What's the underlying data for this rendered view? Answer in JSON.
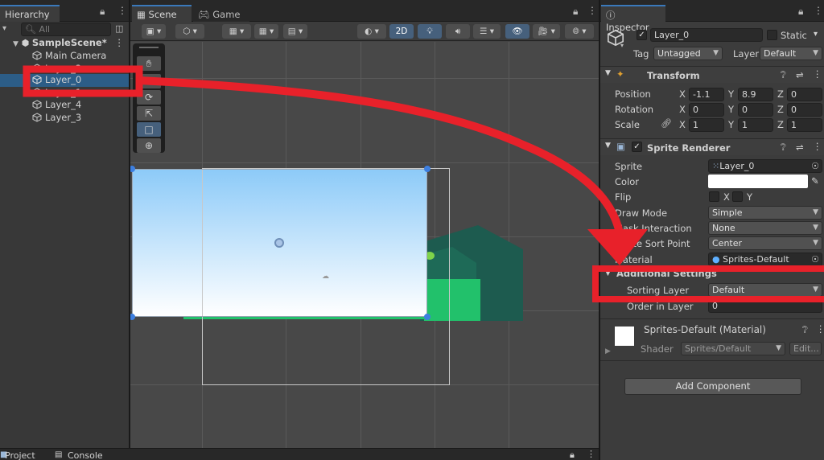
{
  "hierarchy": {
    "tab": "Hierarchy",
    "search_placeholder": "All",
    "scene_name": "SampleScene*",
    "items": [
      "Main Camera",
      "Layer_2",
      "Layer_0",
      "Layer_1",
      "Layer_4",
      "Layer_3"
    ]
  },
  "scene": {
    "tabs": [
      "Scene",
      "Game"
    ],
    "mode_2d": "2D"
  },
  "inspector": {
    "tab": "Inspector",
    "object_name": "Layer_0",
    "static_label": "Static",
    "tag_label": "Tag",
    "tag_value": "Untagged",
    "layer_label": "Layer",
    "layer_value": "Default",
    "transform": {
      "title": "Transform",
      "position_label": "Position",
      "rotation_label": "Rotation",
      "scale_label": "Scale",
      "position": {
        "x": "-1.1",
        "y": "8.9",
        "z": "0"
      },
      "rotation": {
        "x": "0",
        "y": "0",
        "z": "0"
      },
      "scale": {
        "x": "1",
        "y": "1",
        "z": "1"
      }
    },
    "sprite_renderer": {
      "title": "Sprite Renderer",
      "sprite_label": "Sprite",
      "sprite_value": "Layer_0",
      "color_label": "Color",
      "flip_label": "Flip",
      "flip_x": "X",
      "flip_y": "Y",
      "draw_mode_label": "Draw Mode",
      "draw_mode_value": "Simple",
      "mask_label": "Mask Interaction",
      "mask_value": "None",
      "sort_point_label": "Sprite Sort Point",
      "sort_point_value": "Center",
      "material_label": "Material",
      "material_value": "Sprites-Default",
      "additional_settings": "Additional Settings",
      "sorting_layer_label": "Sorting Layer",
      "sorting_layer_value": "Default",
      "order_label": "Order in Layer",
      "order_value": "0"
    },
    "material": {
      "name": "Sprites-Default (Material)",
      "shader_label": "Shader",
      "shader_value": "Sprites/Default",
      "edit_label": "Edit..."
    },
    "add_component": "Add Component"
  },
  "bottom": {
    "tabs": [
      "Project",
      "Console"
    ]
  },
  "colors": {
    "selection": "#2c5d87",
    "annotation_red": "#e8212a",
    "sky_top": "#8ccaf8",
    "grass": "#22c16b",
    "mountain": "#1d5b4f"
  }
}
